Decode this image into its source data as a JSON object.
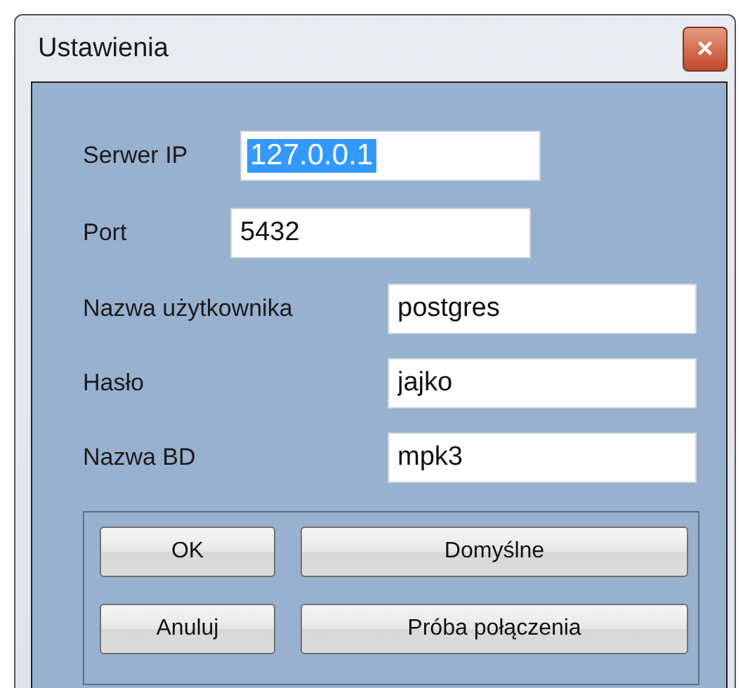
{
  "window": {
    "title": "Ustawienia",
    "close": "×"
  },
  "fields": [
    {
      "kind": "short",
      "label": "Serwer IP",
      "value": "127.0.0.1",
      "highlighted": true
    },
    {
      "kind": "short",
      "label": "Port",
      "value": "5432",
      "highlighted": false
    },
    {
      "kind": "wide",
      "label": "Nazwa użytkownika",
      "value": "postgres",
      "highlighted": false
    },
    {
      "kind": "wide",
      "label": "Hasło",
      "value": "jajko",
      "highlighted": false
    },
    {
      "kind": "wide",
      "label": "Nazwa BD",
      "value": "mpk3",
      "highlighted": false
    }
  ],
  "buttons": [
    {
      "label": "OK",
      "kind": "small"
    },
    {
      "label": "Domyślne",
      "kind": "large"
    },
    {
      "label": "Anuluj",
      "kind": "small"
    },
    {
      "label": "Próba połączenia",
      "kind": "large"
    }
  ]
}
